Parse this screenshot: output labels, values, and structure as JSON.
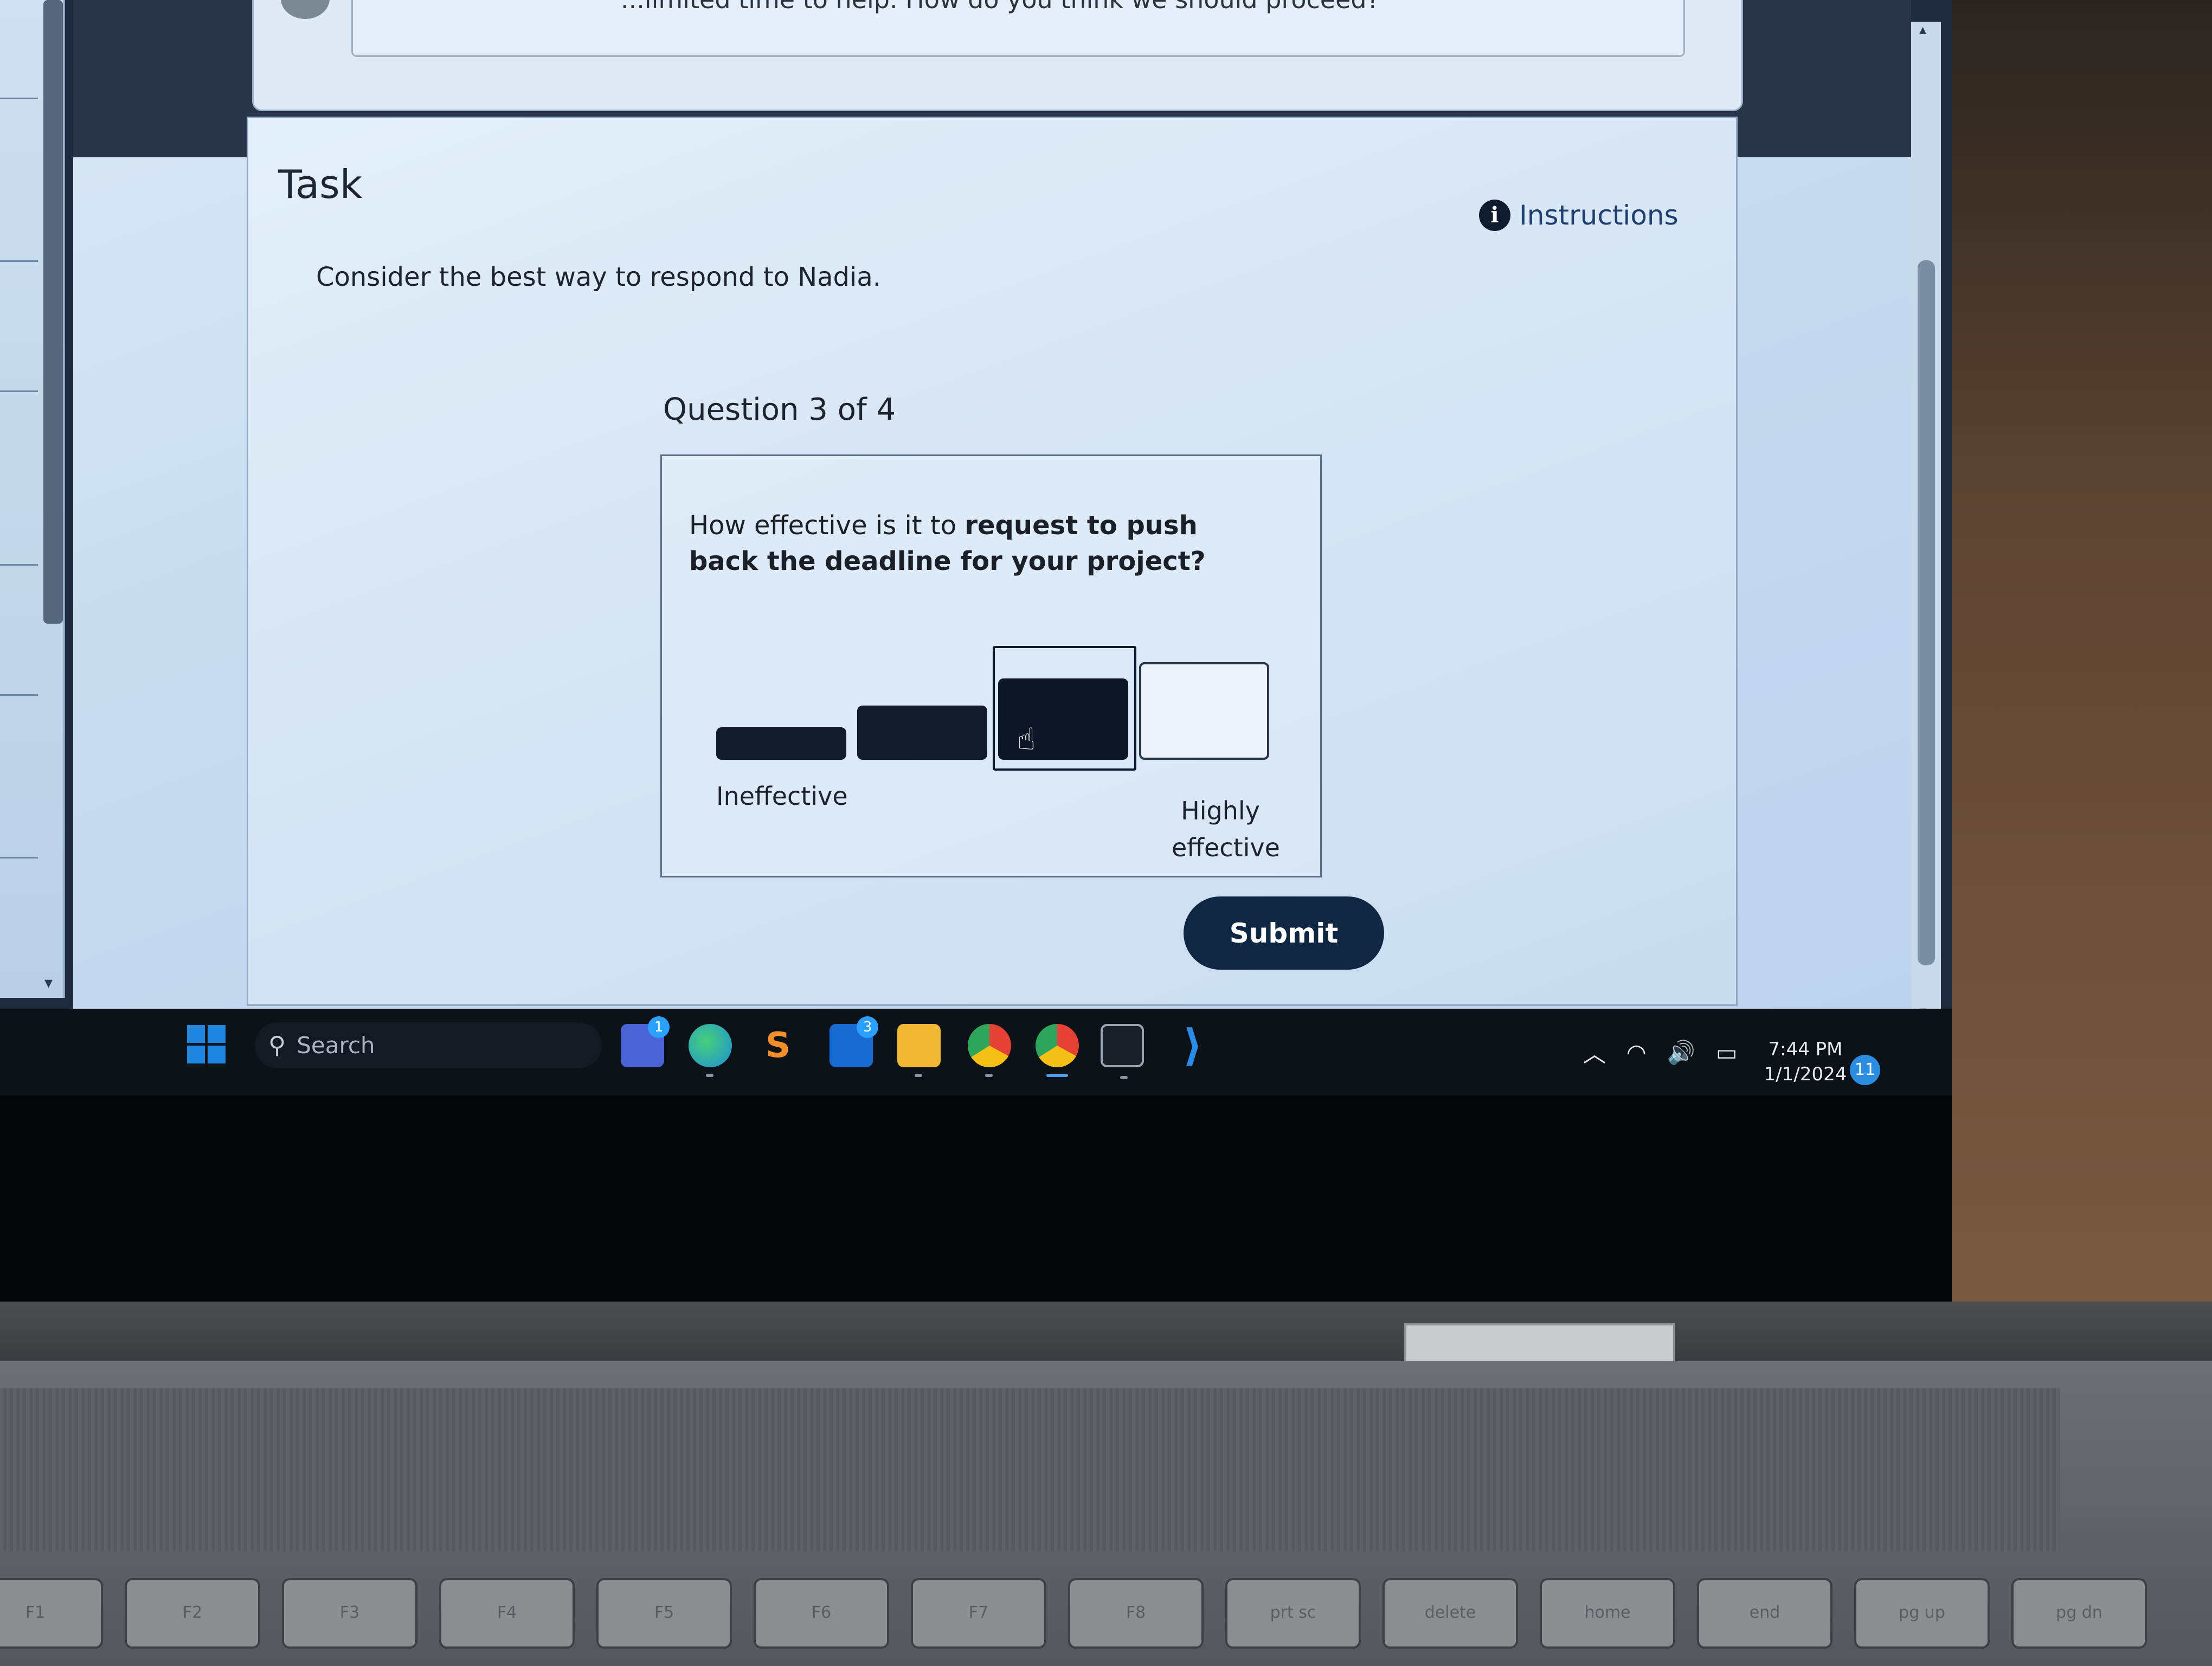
{
  "chat": {
    "text": "...limited time to help. How do you think we should proceed?"
  },
  "task": {
    "title": "Task",
    "instructions_label": "Instructions",
    "prompt": "Consider the best way to respond to Nadia.",
    "question_counter": "Question 3 of 4",
    "question_prefix": "How effective is it to ",
    "question_bold": "request to push back the deadline for your project?",
    "scale": {
      "low_label": "Ineffective",
      "high_label": "Highly effective",
      "options": 4,
      "selected": 3
    },
    "submit_label": "Submit"
  },
  "taskbar": {
    "search_label": "Search",
    "apps": [
      {
        "name": "teams",
        "badge": "1"
      },
      {
        "name": "edge"
      },
      {
        "name": "sublime-text"
      },
      {
        "name": "mail",
        "badge": "3"
      },
      {
        "name": "file-explorer"
      },
      {
        "name": "chrome"
      },
      {
        "name": "chrome-profile"
      },
      {
        "name": "terminal"
      },
      {
        "name": "vs-code"
      }
    ],
    "clock_time": "7:44 PM",
    "clock_date": "1/1/2024",
    "notification_count": "11"
  },
  "icons": {
    "info": "i",
    "search": "⚲",
    "tray_chevron": "︿",
    "wifi": "◠",
    "volume": "🔊",
    "battery": "▭",
    "hand_cursor": "☝"
  },
  "colors": {
    "accent": "#0f2742",
    "link": "#1f3f70",
    "scale_fill": "#111a2a",
    "taskbar": "#0d1118"
  },
  "keyboard": {
    "keys": [
      "F1",
      "F2",
      "F3",
      "F4",
      "F5",
      "F6",
      "F7",
      "F8",
      "prt sc",
      "delete",
      "home",
      "end",
      "pg up",
      "pg dn"
    ]
  }
}
